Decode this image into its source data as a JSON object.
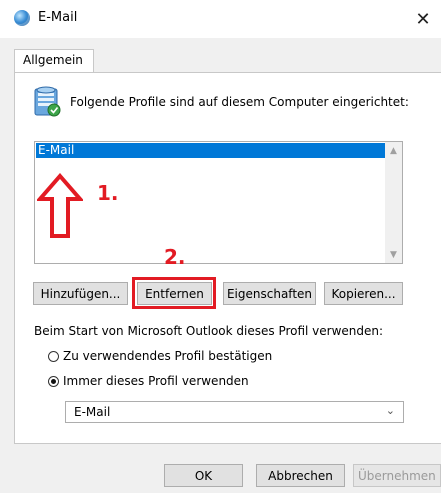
{
  "window": {
    "title": "E-Mail",
    "close_glyph": "✕"
  },
  "tab": {
    "label": "Allgemein"
  },
  "profiles": {
    "header": "Folgende Profile sind auf diesem Computer eingerichtet:",
    "items": [
      "E-Mail"
    ],
    "selected_index": 0
  },
  "buttons": {
    "add": "Hinzufügen...",
    "remove": "Entfernen",
    "properties": "Eigenschaften",
    "copy": "Kopieren..."
  },
  "startup": {
    "label": "Beim Start von Microsoft Outlook dieses Profil verwenden:",
    "options": [
      {
        "label": "Zu verwendendes Profil bestätigen",
        "checked": false
      },
      {
        "label": "Immer dieses Profil verwenden",
        "checked": true
      }
    ],
    "selected_profile": "E-Mail"
  },
  "footer": {
    "ok": "OK",
    "cancel": "Abbrechen",
    "apply": "Übernehmen"
  },
  "annotations": {
    "step1": "1.",
    "step2": "2.",
    "color": "#e21b23"
  },
  "colors": {
    "selection": "#0078d7",
    "accent_red": "#e21b23"
  }
}
